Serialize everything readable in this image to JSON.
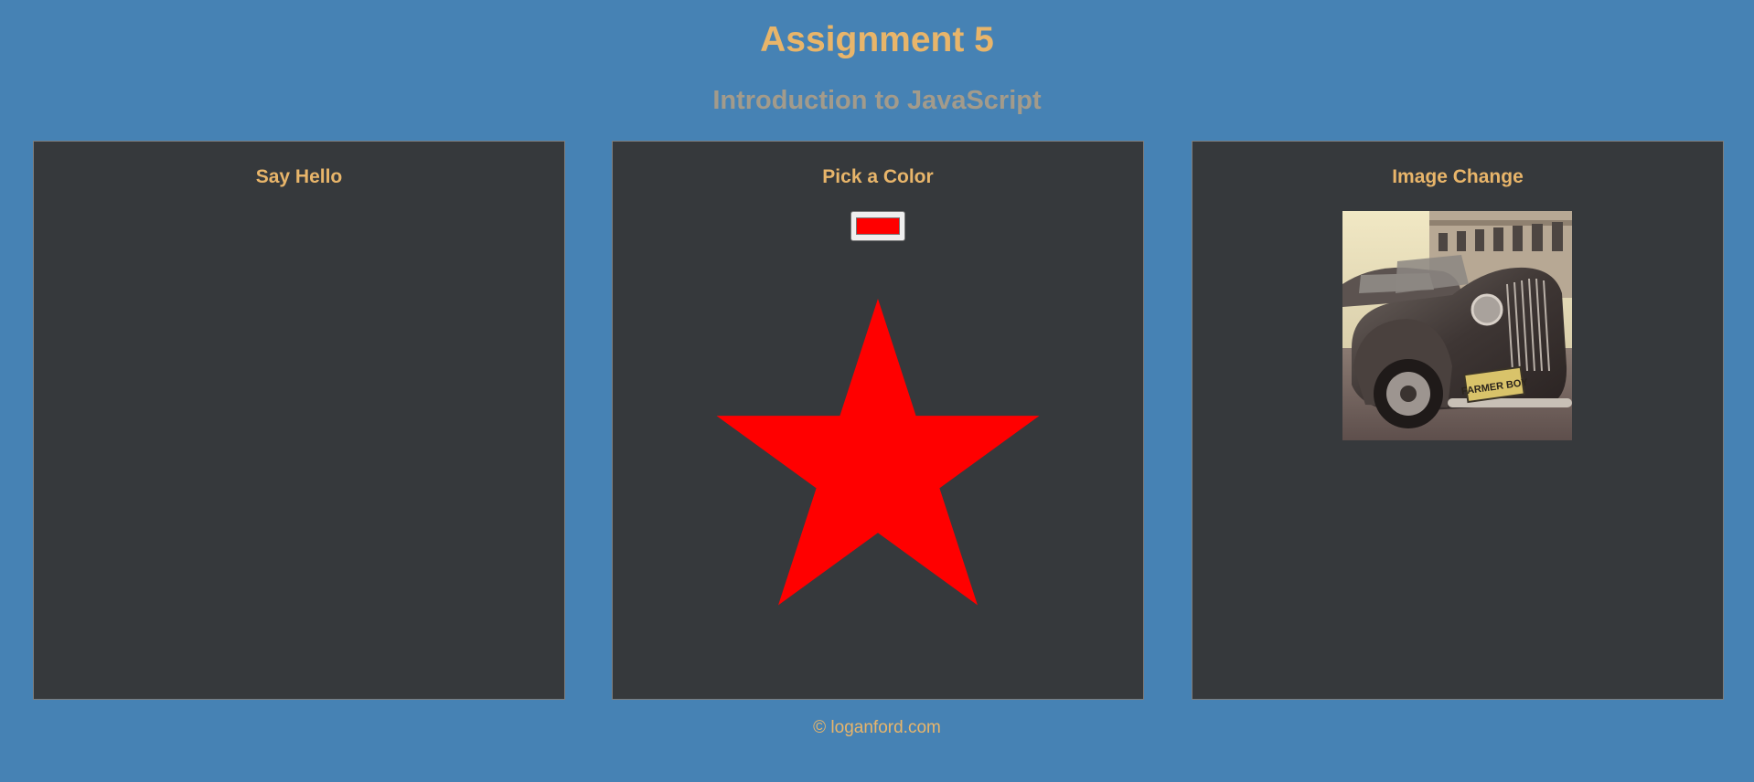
{
  "header": {
    "title": "Assignment 5",
    "subtitle": "Introduction to JavaScript"
  },
  "panels": {
    "hello": {
      "heading": "Say Hello"
    },
    "color": {
      "heading": "Pick a Color",
      "picker_value": "#ff0000",
      "star_color": "#ff0000",
      "star_icon": "star-icon"
    },
    "image": {
      "heading": "Image Change",
      "image_subject": "vintage-car-photo",
      "plate_text": "FARMER BOY"
    }
  },
  "footer": {
    "text": "© loganford.com"
  },
  "colors": {
    "background": "#4682b4",
    "panel": "#36393c",
    "accent": "#e8b56a",
    "subtitle": "#a39b8b"
  }
}
